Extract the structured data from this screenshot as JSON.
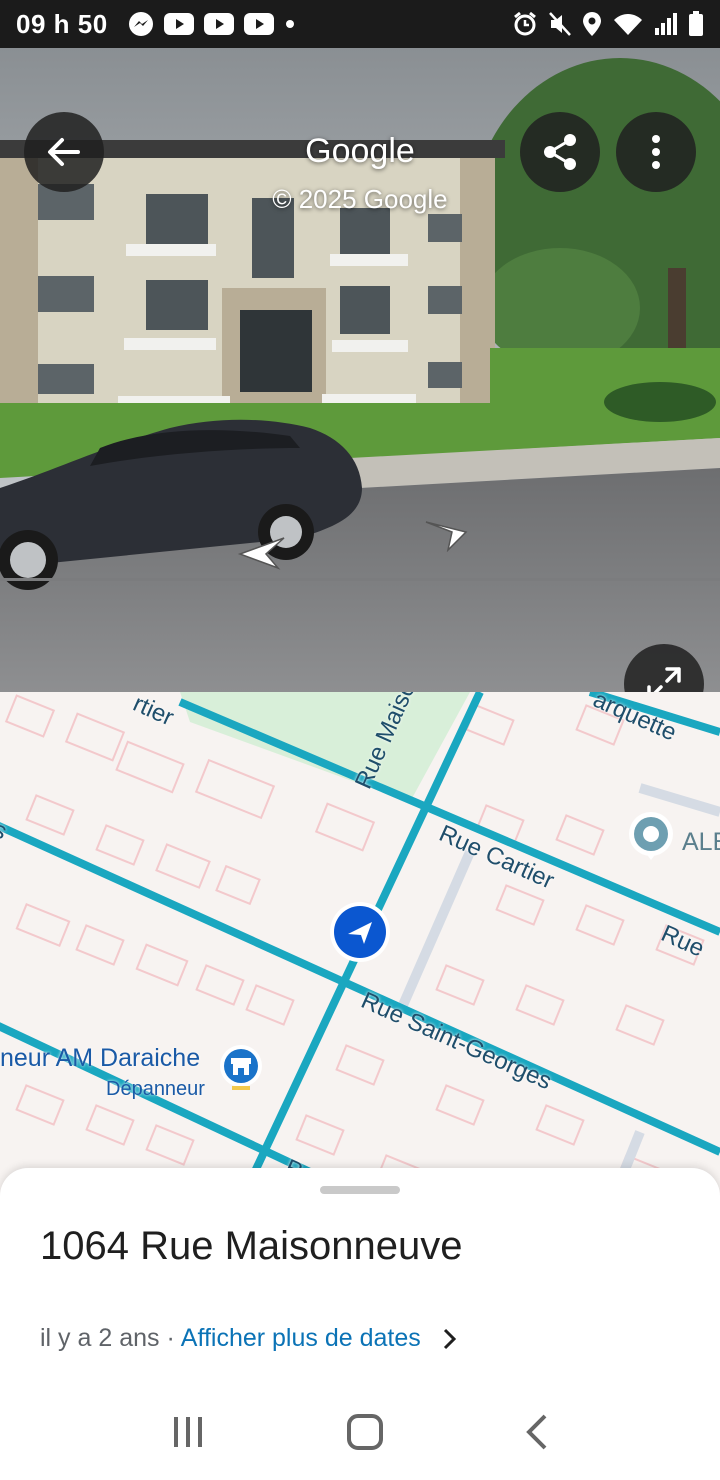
{
  "status_bar": {
    "time": "09 h 50",
    "left_icons": [
      "messenger-icon",
      "youtube-icon",
      "youtube-icon",
      "youtube-icon",
      "dot-icon"
    ],
    "right_icons": [
      "alarm-icon",
      "mute-icon",
      "location-icon",
      "wifi-icon",
      "signal-icon",
      "battery-icon"
    ]
  },
  "streetview": {
    "title": "Google",
    "copyright": "© 2025 Google",
    "buttons": {
      "back": "back-arrow-icon",
      "share": "share-icon",
      "more": "more-vert-icon",
      "expand": "expand-icon"
    }
  },
  "map": {
    "streets": [
      "Rue Maisonneuve",
      "Rue Cartier",
      "Rue Saint-Georges",
      "Rue",
      "rtier",
      "arquette",
      "s",
      "R"
    ],
    "poi": {
      "name": "neur AM Daraiche",
      "category": "Dépanneur"
    },
    "pin_label": "ALE"
  },
  "sheet": {
    "address": "1064 Rue Maisonneuve",
    "age": "il y a 2 ans ·",
    "more_dates": "Afficher plus de dates"
  },
  "colors": {
    "road": "#1aa7c0",
    "link": "#0b73b6",
    "location": "#0b57d0"
  }
}
